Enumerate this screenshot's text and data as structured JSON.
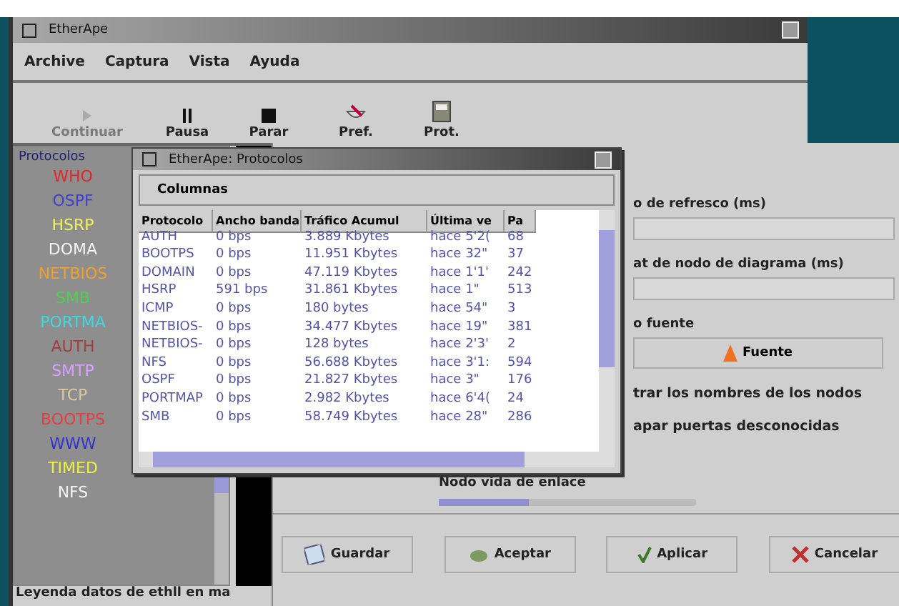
{
  "main_window": {
    "title": "EtherApe",
    "menu": [
      "Archive",
      "Captura",
      "Vista",
      "Ayuda"
    ],
    "toolbar": [
      {
        "label": "Continuar",
        "kind": "play",
        "disabled": true
      },
      {
        "label": "Pausa",
        "kind": "pause",
        "disabled": false
      },
      {
        "label": "Parar",
        "kind": "stop",
        "disabled": false
      },
      {
        "label": "Pref.",
        "kind": "prefs",
        "disabled": false
      },
      {
        "label": "Prot.",
        "kind": "prot",
        "disabled": false
      }
    ],
    "legend": {
      "title": "Protocolos",
      "items": [
        {
          "label": "WHO",
          "color": "#e02828"
        },
        {
          "label": "OSPF",
          "color": "#4040d0"
        },
        {
          "label": "HSRP",
          "color": "#f0f060"
        },
        {
          "label": "DOMA",
          "color": "#f4f4f4"
        },
        {
          "label": "NETBIOS",
          "color": "#f0a030"
        },
        {
          "label": "SMB",
          "color": "#50d050"
        },
        {
          "label": "PORTMA",
          "color": "#40d8e0"
        },
        {
          "label": "AUTH",
          "color": "#a04040"
        },
        {
          "label": "SMTP",
          "color": "#d8a0ff"
        },
        {
          "label": "TCP",
          "color": "#d8c8a0"
        },
        {
          "label": "BOOTPS",
          "color": "#e04040"
        },
        {
          "label": "WWW",
          "color": "#3030d0"
        },
        {
          "label": "TIMED",
          "color": "#f0f040"
        },
        {
          "label": "NFS",
          "color": "#f4f4f4"
        }
      ]
    },
    "status_bar": "Leyenda datos de ethll en ma"
  },
  "protocols_window": {
    "title": "EtherApe: Protocolos",
    "menu": [
      "Columnas"
    ],
    "columns": [
      "Protocolo",
      "Ancho banda",
      "Tráfico Acumul",
      "Última ve",
      "Pa"
    ],
    "rows": [
      [
        "AUTH",
        "0 bps",
        "3.889 Kbytes",
        "hace 5'2(",
        "68"
      ],
      [
        "BOOTPS",
        "0 bps",
        "11.951 Kbytes",
        "hace 32\"",
        "37"
      ],
      [
        "DOMAIN",
        "0 bps",
        "47.119 Kbytes",
        "hace 1'1'",
        "242"
      ],
      [
        "HSRP",
        "591 bps",
        "31.861 Kbytes",
        "hace 1\"",
        "513"
      ],
      [
        "ICMP",
        "0 bps",
        "180 bytes",
        "hace 54\"",
        "3"
      ],
      [
        "NETBIOS-",
        "0 bps",
        "34.477 Kbytes",
        "hace 19\"",
        "381"
      ],
      [
        "NETBIOS-",
        "0 bps",
        "128 bytes",
        "hace 2'3'",
        "2"
      ],
      [
        "NFS",
        "0 bps",
        "56.688 Kbytes",
        "hace 3'1:",
        "594"
      ],
      [
        "OSPF",
        "0 bps",
        "21.827 Kbytes",
        "hace 3\"",
        "176"
      ],
      [
        "PORTMAP",
        "0 bps",
        "2.982 Kbytes",
        "hace 6'4(",
        "24"
      ],
      [
        "SMB",
        "0 bps",
        "58.749 Kbytes",
        "hace 28\"",
        "286"
      ]
    ]
  },
  "preferences": {
    "fields": [
      {
        "kind": "spin",
        "label": "o de refresco (ms)"
      },
      {
        "kind": "spin",
        "label": "at de nodo de diagrama (ms)"
      },
      {
        "kind": "font",
        "label": "o fuente",
        "button": "Fuente"
      },
      {
        "kind": "check",
        "label": "trar los nombres de los nodos"
      },
      {
        "kind": "check",
        "label": "apar puertas desconocidas"
      },
      {
        "kind": "slider",
        "label": "Nodo vida de enlace",
        "level": 0.35
      }
    ],
    "buttons": [
      {
        "label": "Guardar",
        "kind": "save"
      },
      {
        "label": "Aceptar",
        "kind": "ok"
      },
      {
        "label": "Aplicar",
        "kind": "apply"
      },
      {
        "label": "Cancelar",
        "kind": "cancel"
      }
    ]
  }
}
